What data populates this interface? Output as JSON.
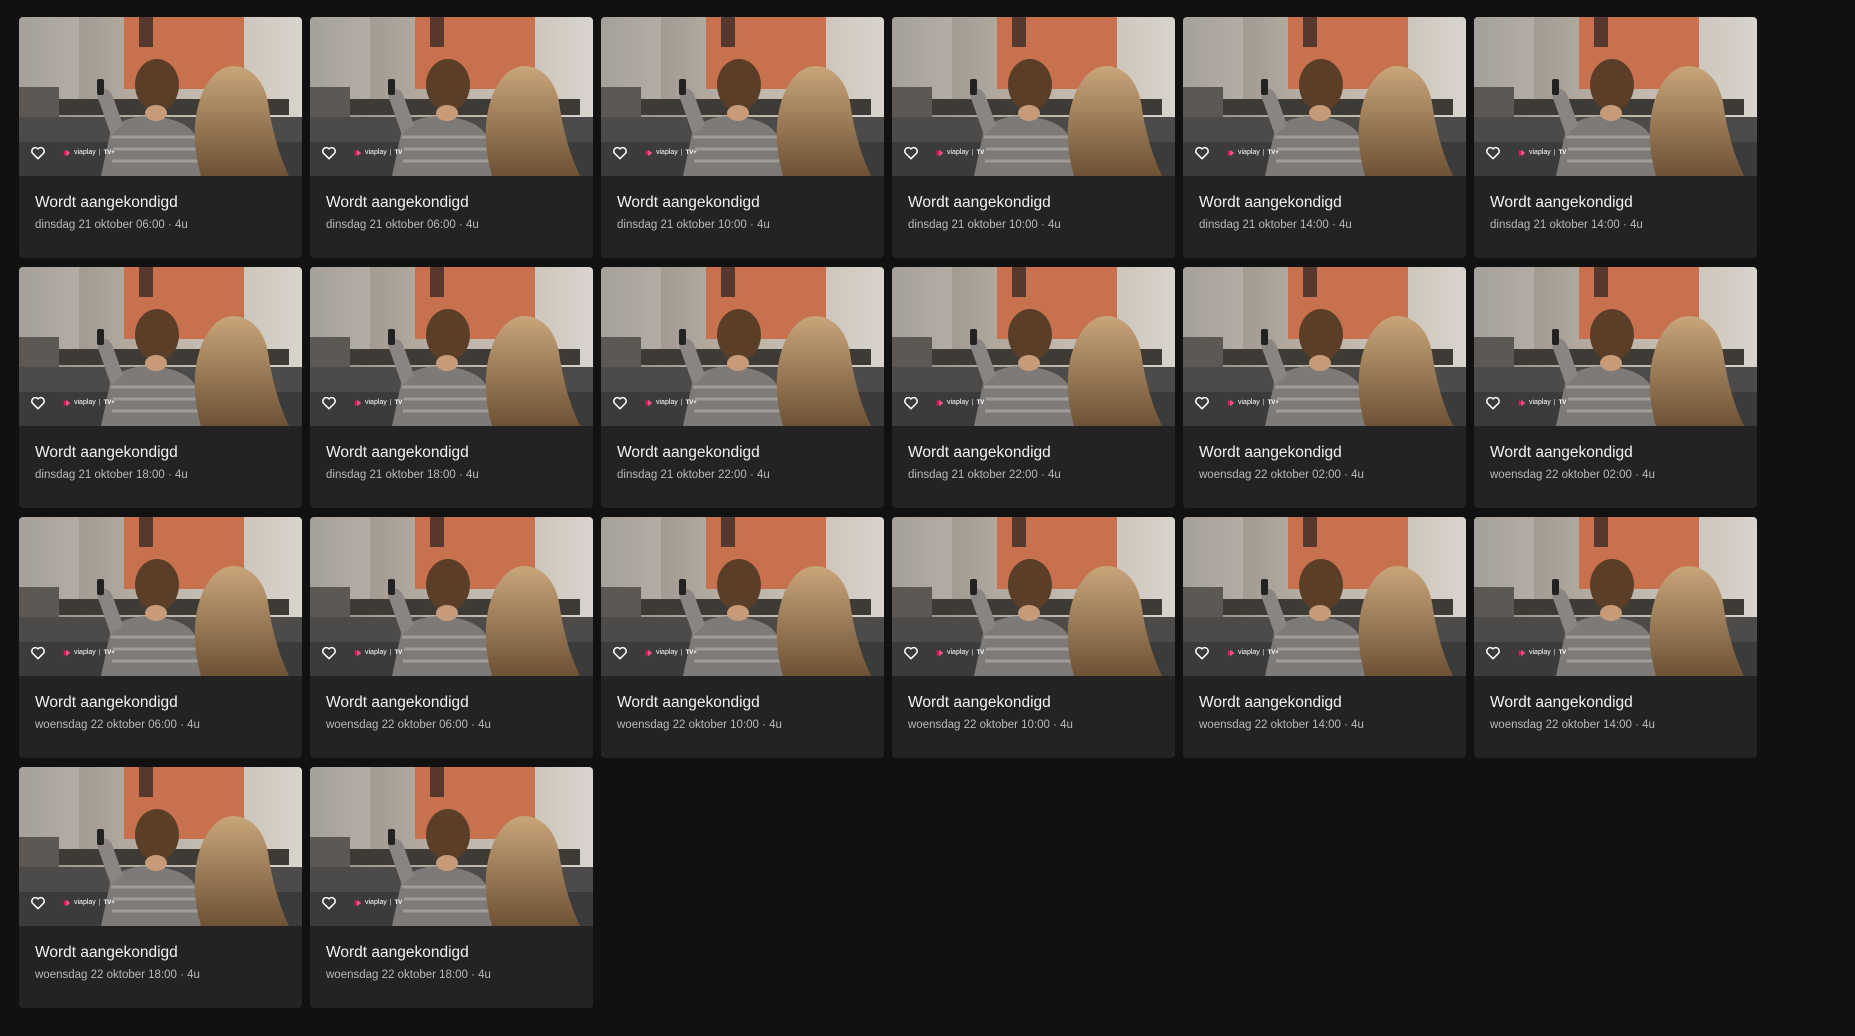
{
  "colors": {
    "background": "#111111",
    "card": "#232323",
    "title": "#f2f2f2",
    "meta": "#b9b9b9",
    "brand_accent": "#e5175b"
  },
  "programs": [
    {
      "title": "Wordt aangekondigd",
      "when": "dinsdag 21 oktober 06:00 · 4u",
      "brand": "viaplay",
      "separator": "|",
      "channel": "TV+",
      "icon": "heart-outline-icon"
    },
    {
      "title": "Wordt aangekondigd",
      "when": "dinsdag 21 oktober 06:00 · 4u",
      "brand": "viaplay",
      "separator": "|",
      "channel": "TV",
      "icon": "heart-outline-icon"
    },
    {
      "title": "Wordt aangekondigd",
      "when": "dinsdag 21 oktober 10:00 · 4u",
      "brand": "viaplay",
      "separator": "|",
      "channel": "TV+",
      "icon": "heart-outline-icon"
    },
    {
      "title": "Wordt aangekondigd",
      "when": "dinsdag 21 oktober 10:00 · 4u",
      "brand": "viaplay",
      "separator": "|",
      "channel": "TV",
      "icon": "heart-outline-icon"
    },
    {
      "title": "Wordt aangekondigd",
      "when": "dinsdag 21 oktober 14:00 · 4u",
      "brand": "viaplay",
      "separator": "|",
      "channel": "TV+",
      "icon": "heart-outline-icon"
    },
    {
      "title": "Wordt aangekondigd",
      "when": "dinsdag 21 oktober 14:00 · 4u",
      "brand": "viaplay",
      "separator": "|",
      "channel": "TV",
      "icon": "heart-outline-icon"
    },
    {
      "title": "Wordt aangekondigd",
      "when": "dinsdag 21 oktober 18:00 · 4u",
      "brand": "viaplay",
      "separator": "|",
      "channel": "TV+",
      "icon": "heart-outline-icon"
    },
    {
      "title": "Wordt aangekondigd",
      "when": "dinsdag 21 oktober 18:00 · 4u",
      "brand": "viaplay",
      "separator": "|",
      "channel": "TV",
      "icon": "heart-outline-icon"
    },
    {
      "title": "Wordt aangekondigd",
      "when": "dinsdag 21 oktober 22:00 · 4u",
      "brand": "viaplay",
      "separator": "|",
      "channel": "TV+",
      "icon": "heart-outline-icon"
    },
    {
      "title": "Wordt aangekondigd",
      "when": "dinsdag 21 oktober 22:00 · 4u",
      "brand": "viaplay",
      "separator": "|",
      "channel": "TV",
      "icon": "heart-outline-icon"
    },
    {
      "title": "Wordt aangekondigd",
      "when": "woensdag 22 oktober 02:00 · 4u",
      "brand": "viaplay",
      "separator": "|",
      "channel": "TV+",
      "icon": "heart-outline-icon"
    },
    {
      "title": "Wordt aangekondigd",
      "when": "woensdag 22 oktober 02:00 · 4u",
      "brand": "viaplay",
      "separator": "|",
      "channel": "TV",
      "icon": "heart-outline-icon"
    },
    {
      "title": "Wordt aangekondigd",
      "when": "woensdag 22 oktober 06:00 · 4u",
      "brand": "viaplay",
      "separator": "|",
      "channel": "TV+",
      "icon": "heart-outline-icon"
    },
    {
      "title": "Wordt aangekondigd",
      "when": "woensdag 22 oktober 06:00 · 4u",
      "brand": "viaplay",
      "separator": "|",
      "channel": "TV",
      "icon": "heart-outline-icon"
    },
    {
      "title": "Wordt aangekondigd",
      "when": "woensdag 22 oktober 10:00 · 4u",
      "brand": "viaplay",
      "separator": "|",
      "channel": "TV+",
      "icon": "heart-outline-icon"
    },
    {
      "title": "Wordt aangekondigd",
      "when": "woensdag 22 oktober 10:00 · 4u",
      "brand": "viaplay",
      "separator": "|",
      "channel": "TV",
      "icon": "heart-outline-icon"
    },
    {
      "title": "Wordt aangekondigd",
      "when": "woensdag 22 oktober 14:00 · 4u",
      "brand": "viaplay",
      "separator": "|",
      "channel": "TV+",
      "icon": "heart-outline-icon"
    },
    {
      "title": "Wordt aangekondigd",
      "when": "woensdag 22 oktober 14:00 · 4u",
      "brand": "viaplay",
      "separator": "|",
      "channel": "TV",
      "icon": "heart-outline-icon"
    },
    {
      "title": "Wordt aangekondigd",
      "when": "woensdag 22 oktober 18:00 · 4u",
      "brand": "viaplay",
      "separator": "|",
      "channel": "TV+",
      "icon": "heart-outline-icon"
    },
    {
      "title": "Wordt aangekondigd",
      "when": "woensdag 22 oktober 18:00 · 4u",
      "brand": "viaplay",
      "separator": "|",
      "channel": "TV",
      "icon": "heart-outline-icon"
    }
  ]
}
